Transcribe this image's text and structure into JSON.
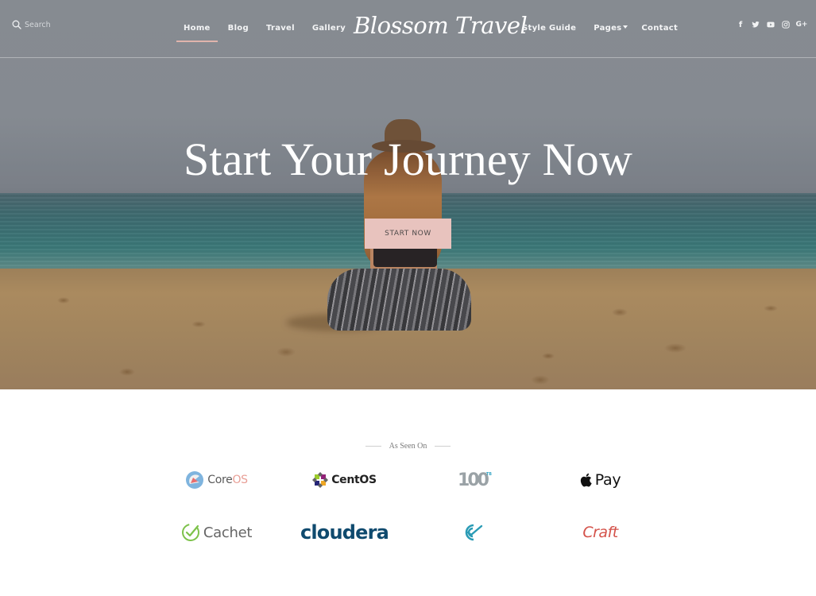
{
  "header": {
    "search": {
      "placeholder": "Search",
      "value": "",
      "icon": "search-icon"
    },
    "nav_left": [
      {
        "label": "Home",
        "active": true
      },
      {
        "label": "Blog",
        "active": false
      },
      {
        "label": "Travel",
        "active": false
      },
      {
        "label": "Gallery",
        "active": false
      }
    ],
    "brand": "Blossom Travel",
    "nav_right": [
      {
        "label": "Style Guide",
        "has_dropdown": false
      },
      {
        "label": "Pages",
        "has_dropdown": true
      },
      {
        "label": "Contact",
        "has_dropdown": false
      }
    ],
    "social": [
      {
        "icon": "facebook-icon",
        "glyph": "f"
      },
      {
        "icon": "twitter-icon",
        "glyph": ""
      },
      {
        "icon": "youtube-icon",
        "glyph": ""
      },
      {
        "icon": "instagram-icon",
        "glyph": ""
      },
      {
        "icon": "google-plus-icon",
        "glyph": "G+"
      }
    ]
  },
  "hero": {
    "title": "Start Your Journey Now",
    "cta_label": "START NOW"
  },
  "as_seen_on": {
    "label": "As Seen On",
    "logos": [
      {
        "name": "CoreOS",
        "text_a": "Core",
        "text_b": "OS"
      },
      {
        "name": "CentOS",
        "text": "CentOS"
      },
      {
        "name": "100TB",
        "text": "100",
        "sup": "TB"
      },
      {
        "name": "Apple Pay",
        "text": "Pay"
      },
      {
        "name": "Cachet",
        "text": "Cachet"
      },
      {
        "name": "Cloudera",
        "text": "cloudera"
      },
      {
        "name": "Codecov check logo",
        "text": ""
      },
      {
        "name": "Craft",
        "text": "Craft"
      }
    ]
  },
  "colors": {
    "accent_pink": "#e8c3be",
    "nav_underline": "#e0b4ac",
    "cloudera_blue": "#0f4a6e",
    "craft_red": "#d4524a",
    "cachet_green": "#7dc24b"
  }
}
